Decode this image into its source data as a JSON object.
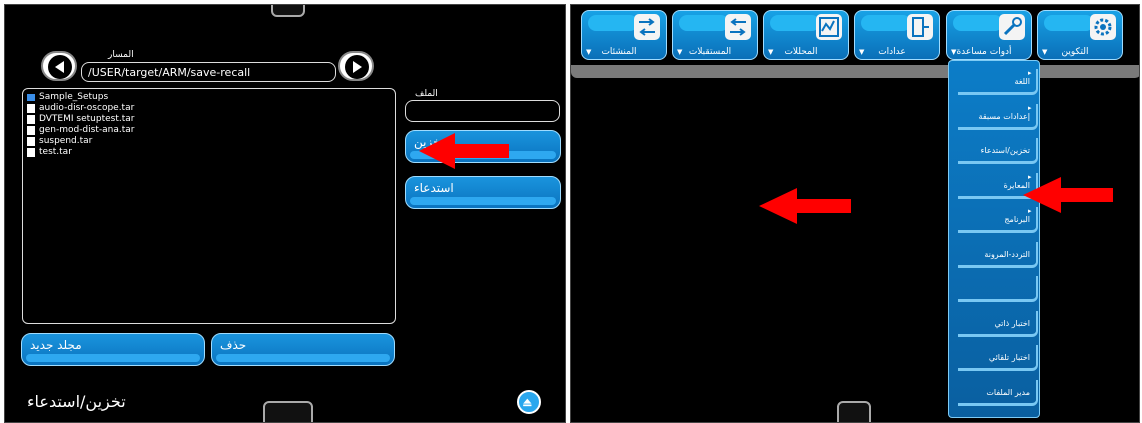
{
  "left_panel": {
    "path_label": "المسار",
    "path_value": "/USER/target/ARM/save-recall",
    "file_label": "الملف",
    "file_value": "",
    "files": [
      {
        "name": "Sample_Setups",
        "type": "folder"
      },
      {
        "name": "audio-disr-oscope.tar",
        "type": "file"
      },
      {
        "name": "DVTEMI setuptest.tar",
        "type": "file"
      },
      {
        "name": "gen-mod-dist-ana.tar",
        "type": "file"
      },
      {
        "name": "suspend.tar",
        "type": "file"
      },
      {
        "name": "test.tar",
        "type": "file"
      }
    ],
    "buttons": {
      "store": "تخزين",
      "recall": "استدعاء",
      "new_folder": "مجلد جديد",
      "delete": "حذف"
    },
    "screen_title": "تخزين/استدعاء"
  },
  "right_panel": {
    "tabs": [
      {
        "label": "المنشئات",
        "icon": "generator-icon"
      },
      {
        "label": "المستقبلات",
        "icon": "receiver-icon"
      },
      {
        "label": "المحللات",
        "icon": "analyzer-icon"
      },
      {
        "label": "عدادات",
        "icon": "meter-icon"
      },
      {
        "label": "أدوات مساعدة",
        "icon": "wrench-icon"
      },
      {
        "label": "التكوين",
        "icon": "gear-icon"
      }
    ],
    "menu_items": [
      {
        "label": "اللغة",
        "submenu": true
      },
      {
        "label": "إعدادات مسبقة",
        "submenu": true
      },
      {
        "label": "تخزين/استدعاء",
        "submenu": false
      },
      {
        "label": "المعايرة",
        "submenu": true
      },
      {
        "label": "البرنامج",
        "submenu": true
      },
      {
        "label": "التردد-المرونة",
        "submenu": false
      },
      {
        "label": "",
        "submenu": false
      },
      {
        "label": "اختبار ذاتي",
        "submenu": false
      },
      {
        "label": "اختبار تلقائي",
        "submenu": false
      },
      {
        "label": "مدير الملفات",
        "submenu": false
      }
    ]
  },
  "colors": {
    "accent_blue": "#0a73bf",
    "arrow_red": "#ff0000"
  }
}
